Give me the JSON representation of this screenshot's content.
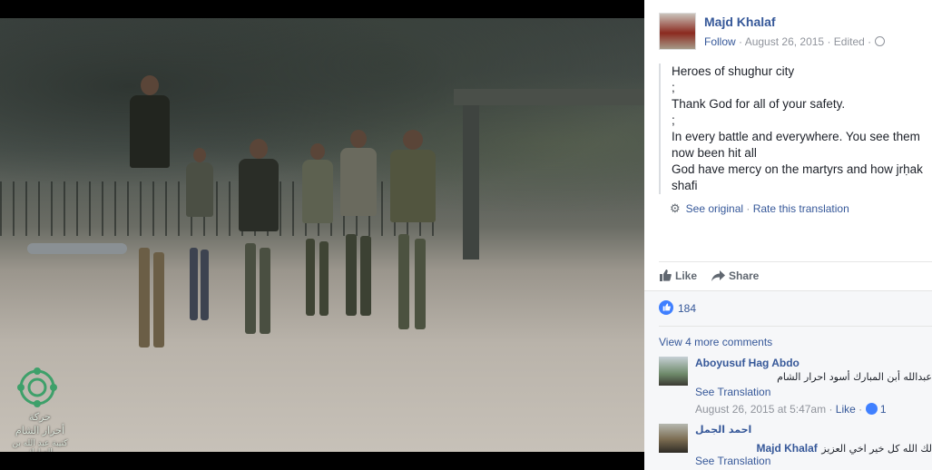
{
  "post": {
    "author": "Majd Khalaf",
    "follow": "Follow",
    "date": "August 26, 2015",
    "edited": "Edited",
    "separator": "·",
    "lines": [
      "Heroes of shughur city",
      ";",
      "Thank God for all of your safety.",
      ";",
      "In every battle and everywhere. You see them",
      "now been hit all",
      "God have mercy on the martyrs and how jrḥak",
      "shafi"
    ],
    "see_original": "See original",
    "rate_translation": "Rate this translation"
  },
  "actions": {
    "like": "Like",
    "share": "Share"
  },
  "reactions": {
    "count": "184"
  },
  "comments": {
    "view_more": "View 4 more comments",
    "items": [
      {
        "name": "Aboyusuf Hag Abdo",
        "text": "عبدالله أبن المبارك أسود احرار الشام",
        "translation": "See Translation",
        "date": "August 26, 2015 at 5:47am",
        "like": "Like",
        "likes": "1"
      },
      {
        "name": "احمد الجمل",
        "mention": "Majd Khalaf",
        "text": "لك الله كل خير اخي العزيز",
        "translation": "See Translation"
      }
    ]
  },
  "watermark": {
    "line1": "حركة",
    "line2": "أحرار الشام",
    "line3": "كتيبة عبد الله بن المبارك"
  },
  "icons": {
    "settings": "gear-icon",
    "like": "thumbs-up-icon",
    "share": "share-arrow-icon",
    "privacy": "globe-icon"
  },
  "colors": {
    "link": "#365899",
    "like_blue": "#4080ff"
  }
}
